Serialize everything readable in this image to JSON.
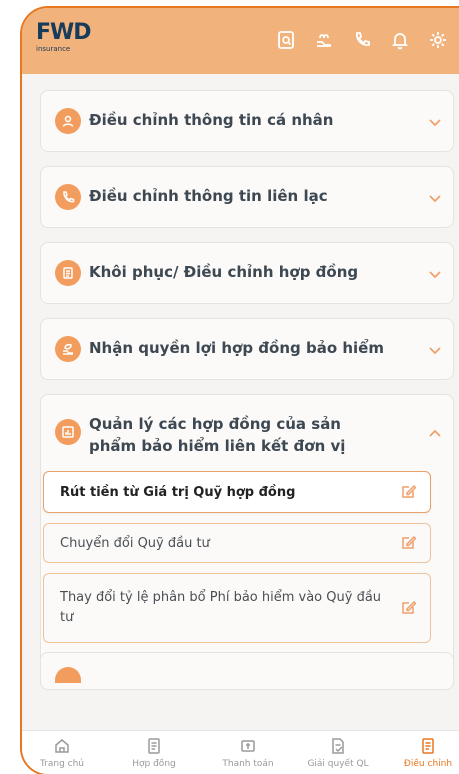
{
  "brand": {
    "logo_text": "FWD",
    "logo_sub": "insurance",
    "accent": "#e87722",
    "header_bg": "#f2b27c"
  },
  "header_icons": [
    "document-search-icon",
    "gift-hand-icon",
    "phone-icon",
    "bell-icon",
    "gear-icon"
  ],
  "cards": [
    {
      "title": "Điều chỉnh thông tin cá nhân",
      "icon": "user-icon"
    },
    {
      "title": "Điều chỉnh thông tin liên lạc",
      "icon": "phone-icon"
    },
    {
      "title": "Khôi phục/ Điều chỉnh hợp đồng",
      "icon": "clipboard-icon"
    },
    {
      "title": "Nhận quyền lợi hợp đồng bảo hiểm",
      "icon": "leaf-hand-icon"
    }
  ],
  "expanded_card": {
    "title": "Quản lý các hợp đồng của sản phẩm bảo hiểm liên kết đơn vị",
    "icon": "chart-icon",
    "items": [
      {
        "label": "Rút tiền từ Giá trị Quỹ hợp đồng",
        "active": true
      },
      {
        "label": "Chuyển đổi Quỹ đầu tư",
        "active": false
      },
      {
        "label": "Thay đổi tỷ lệ phân bổ Phí bảo hiểm vào Quỹ đầu tư",
        "active": false
      }
    ]
  },
  "tabs": [
    {
      "label": "Trang chủ",
      "icon": "home-icon",
      "active": false
    },
    {
      "label": "Hợp đồng",
      "icon": "contract-icon",
      "active": false
    },
    {
      "label": "Thanh toán",
      "icon": "payment-icon",
      "active": false
    },
    {
      "label": "Giải quyết QL",
      "icon": "claim-icon",
      "active": false
    },
    {
      "label": "Điều chỉnh",
      "icon": "adjust-icon",
      "active": true
    }
  ]
}
